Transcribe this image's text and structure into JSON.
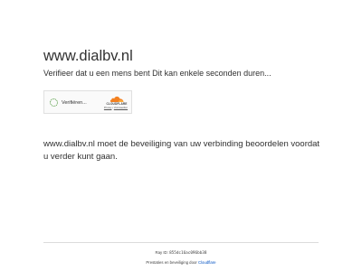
{
  "page": {
    "domain_title": "www.dialbv.nl",
    "verify_message": "Verifieer dat u een mens bent Dit kan enkele seconden duren...",
    "security_message": "www.dialbv.nl moet de beveiliging van uw verbinding beoordelen voordat u verder kunt gaan."
  },
  "widget": {
    "status_label": "Verifiëren...",
    "brand_text": "CLOUDFLARE",
    "privacy_link": "Privacy",
    "terms_link": "Voorwaarden",
    "link_separator": " • "
  },
  "footer": {
    "ray_label": "Ray ID: ",
    "ray_id": "855dc16ac096bb38",
    "performance_prefix": "Prestaties en beveiliging door ",
    "cloudflare_link": "Cloudflare"
  },
  "colors": {
    "spinner": "#3f8f2a",
    "cloudflare_orange": "#f38020",
    "link": "#0051c3"
  }
}
